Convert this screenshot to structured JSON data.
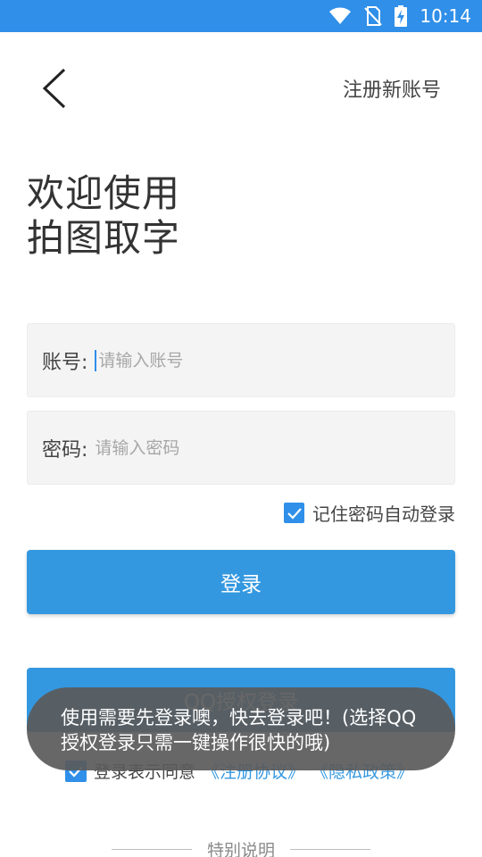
{
  "status_bar": {
    "time": "10:14",
    "bg_color": "#2f8fe9"
  },
  "header": {
    "register_label": "注册新账号"
  },
  "welcome": {
    "line1": "欢迎使用",
    "line2": "拍图取字"
  },
  "account": {
    "label": "账号:",
    "placeholder": "请输入账号",
    "value": ""
  },
  "password": {
    "label": "密码:",
    "placeholder": "请输入密码",
    "value": ""
  },
  "remember": {
    "label": "记住密码自动登录",
    "checked": true
  },
  "login": {
    "label": "登录"
  },
  "qq_login": {
    "label": "QQ授权登录"
  },
  "agreement": {
    "text": "登录表示同意",
    "terms": "《注册协议》",
    "privacy": "《隐私政策》",
    "checked": true
  },
  "special": {
    "label": "特别说明"
  },
  "toast": {
    "message": "使用需要先登录噢，快去登录吧！(选择QQ授权登录只需一键操作很快的哦)"
  },
  "accent_color": "#3498e0"
}
